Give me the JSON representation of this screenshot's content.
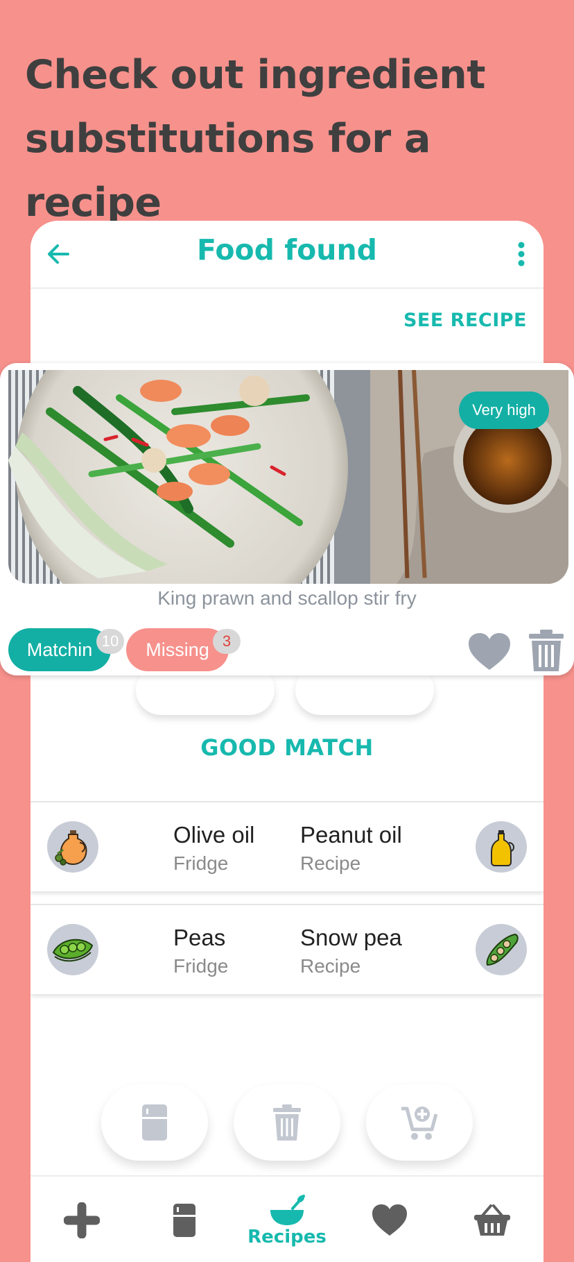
{
  "promo": {
    "headline": "Check out ingredient substitutions for a recipe"
  },
  "appbar": {
    "title": "Food found",
    "back_icon": "arrow-left-icon",
    "menu_icon": "more-vertical-icon"
  },
  "see_recipe_label": "SEE RECIPE",
  "recipe_card": {
    "title": "King prawn and scallop stir fry",
    "score_label": "Very high",
    "matching": {
      "label": "Matchin",
      "count": "10"
    },
    "missing": {
      "label": "Missing",
      "count": "3"
    }
  },
  "section_title": "GOOD MATCH",
  "substitutions": [
    {
      "have": {
        "name": "Olive oil",
        "location": "Fridge",
        "icon": "olive-oil-jar-icon"
      },
      "sub": {
        "name": "Peanut oil",
        "location": "Recipe",
        "icon": "oil-bottle-icon"
      }
    },
    {
      "have": {
        "name": "Peas",
        "location": "Fridge",
        "icon": "peas-icon"
      },
      "sub": {
        "name": "Snow pea",
        "location": "Recipe",
        "icon": "snow-pea-icon"
      }
    }
  ],
  "actions": [
    "fridge-icon",
    "trash-icon",
    "cart-add-icon"
  ],
  "bottom_nav": {
    "items": [
      {
        "icon": "plus-icon"
      },
      {
        "icon": "fridge-icon"
      },
      {
        "icon": "mixing-bowl-icon",
        "label": "Recipes",
        "active": true
      },
      {
        "icon": "heart-icon"
      },
      {
        "icon": "basket-icon"
      }
    ]
  },
  "colors": {
    "background": "#F7918C",
    "accent": "#17B9AE",
    "missing": "#F7918C",
    "inactive_icon": "#5F5F5F",
    "muted_icon": "#C2C7D0"
  }
}
